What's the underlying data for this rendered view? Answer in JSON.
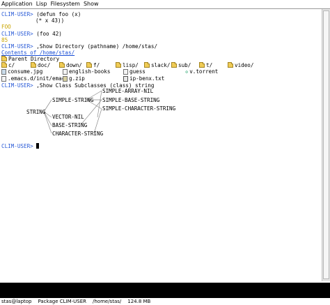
{
  "menu": [
    "Application",
    "Lisp",
    "Filesystem",
    "Show"
  ],
  "listener": {
    "prompt": "CLIM-USER>",
    "cmd1_line1": "(defun foo (x)",
    "cmd1_line2": "(* x 43))",
    "result1": "FOO",
    "cmd2": "(foo 42)",
    "result2": "85",
    "cmd3": ",Show Directory (pathname) /home/stas/",
    "contents_title": "Contents of /home/stas/",
    "parent_dir": "Parent Directory",
    "cmd4": ",Show Class Subclasses (class) string"
  },
  "directory": {
    "folders": [
      "c/",
      "doc/",
      "down/",
      "f/",
      "lisp/",
      "slack/",
      "sub/",
      "t/",
      "video/"
    ],
    "files_row2": [
      {
        "name": "consume.jpg",
        "icon": "image-file-icon"
      },
      {
        "name": "english-books",
        "icon": "text-file-icon"
      },
      {
        "name": "guess",
        "icon": "text-file-icon"
      },
      {
        "name": "v.torrent",
        "icon": "torrent-file-icon"
      }
    ],
    "files_row3": [
      {
        "name": ".emacs.d/init/emacs",
        "icon": "text-file-icon"
      },
      {
        "name": "g.zip",
        "icon": "archive-file-icon"
      },
      {
        "name": "ip-benx.txt",
        "icon": "document-file-icon"
      }
    ]
  },
  "class_graph": {
    "root": "STRING",
    "level1": [
      "SIMPLE-STRING",
      "VECTOR-NIL",
      "BASE-STRING",
      "CHARACTER-STRING"
    ],
    "level2": [
      "SIMPLE-ARRAY-NIL",
      "SIMPLE-BASE-STRING",
      "SIMPLE-CHARACTER-STRING"
    ]
  },
  "status": {
    "host": "stas@laptop",
    "package": "Package CLIM-USER",
    "dir": "/home/stas/",
    "memory": "124.8 MB"
  }
}
